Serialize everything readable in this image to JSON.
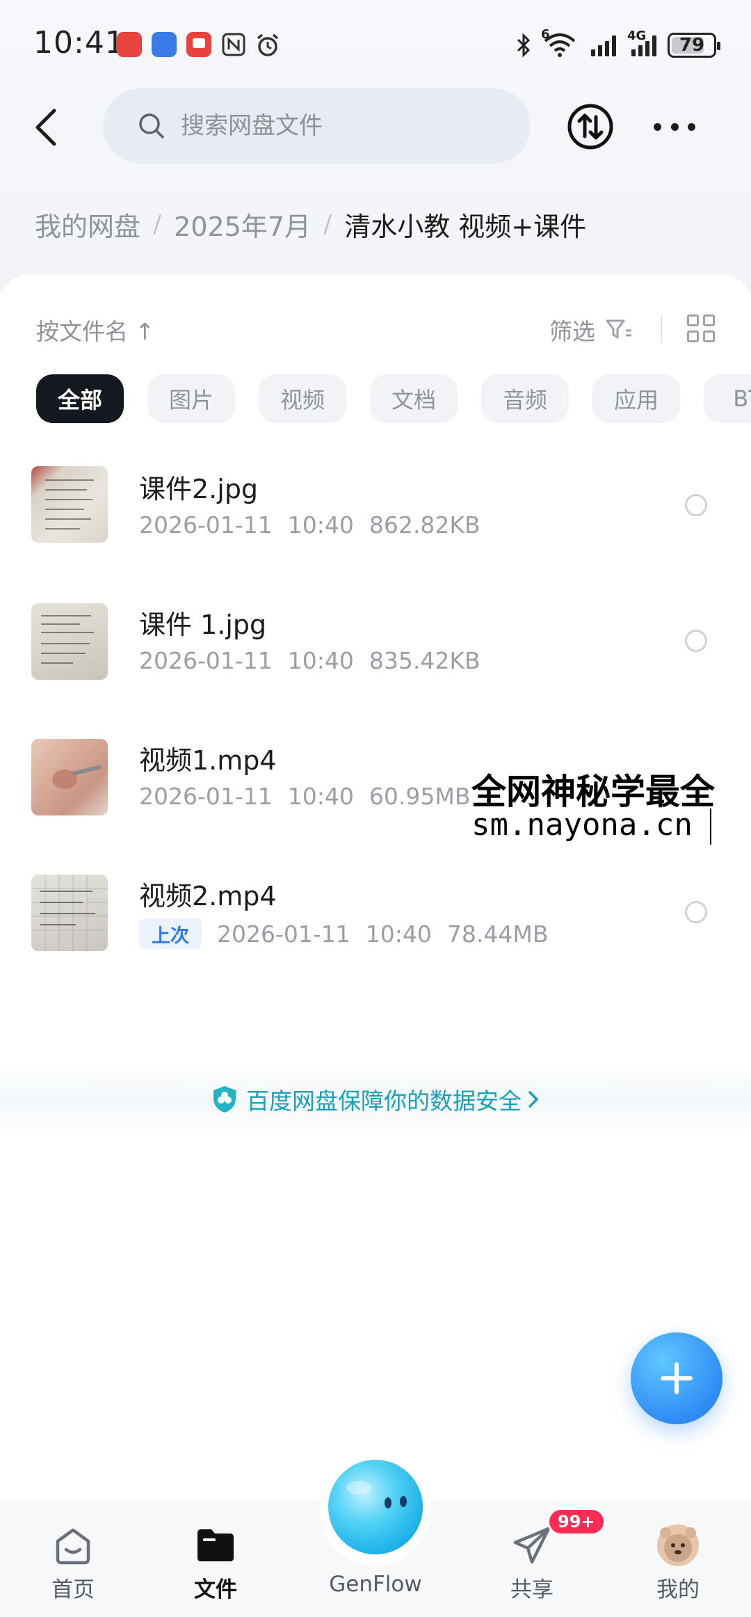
{
  "status_bar": {
    "time": "10:41",
    "battery": "79",
    "wifi_label": "6",
    "network_label": "4G"
  },
  "header": {
    "search_placeholder": "搜索网盘文件"
  },
  "breadcrumb": {
    "items": [
      "我的网盘",
      "2025年7月"
    ],
    "separator": "/",
    "current": "清水小教 视频+课件"
  },
  "toolbar": {
    "sort_label": "按文件名 ↑",
    "filter_label": "筛选"
  },
  "chips": [
    {
      "label": "全部",
      "active": true
    },
    {
      "label": "图片",
      "active": false
    },
    {
      "label": "视频",
      "active": false
    },
    {
      "label": "文档",
      "active": false
    },
    {
      "label": "音频",
      "active": false
    },
    {
      "label": "应用",
      "active": false
    },
    {
      "label": "BT",
      "active": false
    }
  ],
  "files": [
    {
      "name": "课件2.jpg",
      "date": "2026-01-11",
      "time": "10:40",
      "size": "862.82KB",
      "tag": ""
    },
    {
      "name": "课件 1.jpg",
      "date": "2026-01-11",
      "time": "10:40",
      "size": "835.42KB",
      "tag": ""
    },
    {
      "name": "视频1.mp4",
      "date": "2026-01-11",
      "time": "10:40",
      "size": "60.95MB",
      "tag": ""
    },
    {
      "name": "视频2.mp4",
      "date": "2026-01-11",
      "time": "10:40",
      "size": "78.44MB",
      "tag": "上次"
    }
  ],
  "watermark": {
    "line1": "全网神秘学最全",
    "line2": "sm.nayona.cn"
  },
  "security_banner": {
    "text": "百度网盘保障你的数据安全"
  },
  "bottom_nav": {
    "items": [
      {
        "label": "首页",
        "active": false
      },
      {
        "label": "文件",
        "active": true
      },
      {
        "label": "GenFlow",
        "active": false
      },
      {
        "label": "共享",
        "active": false
      },
      {
        "label": "我的",
        "active": false
      }
    ],
    "share_badge": "99+"
  },
  "colors": {
    "accent_blue": "#2f8df5",
    "security_teal": "#16a1b8",
    "badge_red": "#ff2d55",
    "active_chip": "#141820"
  }
}
